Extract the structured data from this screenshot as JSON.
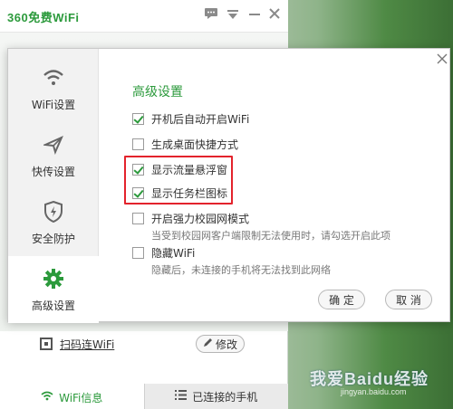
{
  "app": {
    "brand": "360免费WiFi",
    "header_icons": {
      "chat": "chat-icon",
      "dropdown": "chevron-down-icon",
      "minimize": "minimize-icon",
      "close": "close-icon"
    }
  },
  "background": {
    "scan_link": "扫码连WiFi",
    "edit_button": "修改",
    "tabs": [
      {
        "label": "WiFi信息",
        "icon": "wifi-icon"
      },
      {
        "label": "已连接的手机",
        "icon": "list-icon"
      }
    ],
    "watermark": "我爱Baidu经验",
    "watermark_sub": "jingyan.baidu.com"
  },
  "dialog": {
    "sidebar": [
      {
        "label": "WiFi设置",
        "icon": "wifi-icon"
      },
      {
        "label": "快传设置",
        "icon": "send-icon"
      },
      {
        "label": "安全防护",
        "icon": "shield-icon"
      },
      {
        "label": "高级设置",
        "icon": "gear-icon",
        "active": true
      }
    ],
    "section_title": "高级设置",
    "options": [
      {
        "label": "开机后自动开启WiFi",
        "checked": true
      },
      {
        "label": "生成桌面快捷方式",
        "checked": false
      },
      {
        "label": "显示流量悬浮窗",
        "checked": true
      },
      {
        "label": "显示任务栏图标",
        "checked": true
      },
      {
        "label": "开启强力校园网模式",
        "checked": false,
        "desc": "当受到校园网客户端限制无法使用时，请勾选开启此项"
      },
      {
        "label": "隐藏WiFi",
        "checked": false,
        "desc": "隐藏后，未连接的手机将无法找到此网络"
      }
    ],
    "ok_button": "确 定",
    "cancel_button": "取 消"
  },
  "colors": {
    "accent": "#2c9a3c",
    "highlight": "#e3232c"
  }
}
